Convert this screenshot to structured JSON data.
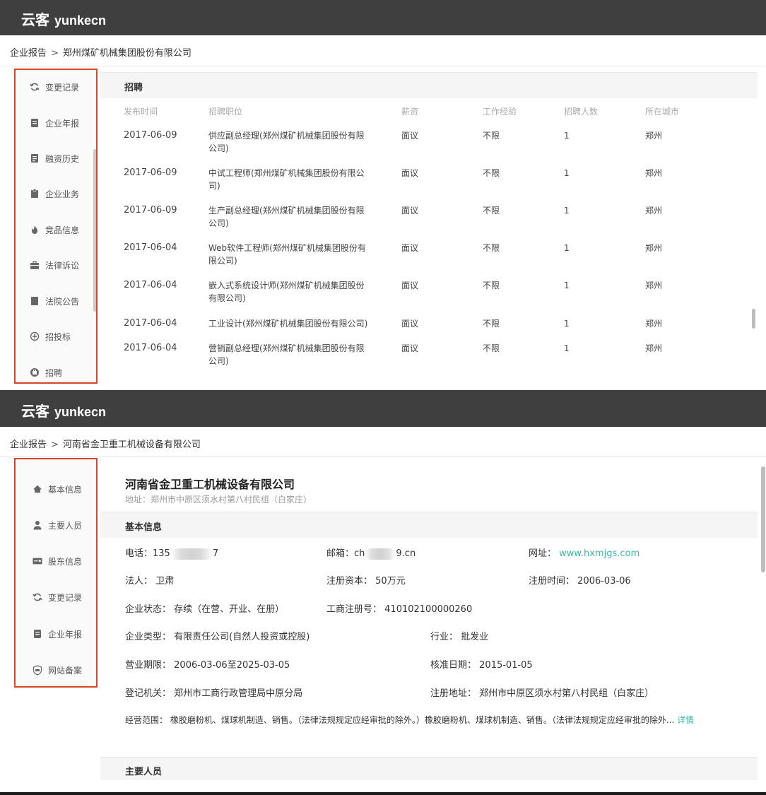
{
  "brand": {
    "cn": "云客",
    "latin": "yunkecn"
  },
  "breadcrumb_separator": ">",
  "panel1": {
    "breadcrumb": {
      "root": "企业报告",
      "current": "郑州煤矿机械集团股份有限公司"
    },
    "sidebar": [
      {
        "label": "变更记录",
        "icon": "refresh-icon"
      },
      {
        "label": "企业年报",
        "icon": "report-icon"
      },
      {
        "label": "融资历史",
        "icon": "document-icon"
      },
      {
        "label": "企业业务",
        "icon": "clipboard-icon"
      },
      {
        "label": "竞品信息",
        "icon": "flame-icon"
      },
      {
        "label": "法律诉讼",
        "icon": "briefcase-icon"
      },
      {
        "label": "法院公告",
        "icon": "notice-icon"
      },
      {
        "label": "招投标",
        "icon": "bid-icon"
      },
      {
        "label": "招聘",
        "icon": "recruit-icon"
      }
    ],
    "section_title": "招聘",
    "columns": [
      "发布时间",
      "招聘职位",
      "薪资",
      "工作经验",
      "招聘人数",
      "所在城市"
    ],
    "rows": [
      {
        "date": "2017-06-09",
        "position_l1": "供应副总经理(郑州煤矿机械集团股份有限",
        "position_l2": "公司)",
        "salary": "面议",
        "experience": "不限",
        "count": "1",
        "city": "郑州"
      },
      {
        "date": "2017-06-09",
        "position_l1": "中试工程师(郑州煤矿机械集团股份有限公",
        "position_l2": "司)",
        "salary": "面议",
        "experience": "不限",
        "count": "1",
        "city": "郑州"
      },
      {
        "date": "2017-06-09",
        "position_l1": "生产副总经理(郑州煤矿机械集团股份有限",
        "position_l2": "公司)",
        "salary": "面议",
        "experience": "不限",
        "count": "1",
        "city": "郑州"
      },
      {
        "date": "2017-06-04",
        "position_l1": "Web软件工程师(郑州煤矿机械集团股份有",
        "position_l2": "限公司)",
        "salary": "面议",
        "experience": "不限",
        "count": "1",
        "city": "郑州"
      },
      {
        "date": "2017-06-04",
        "position_l1": "嵌入式系统设计师(郑州煤矿机械集团股份",
        "position_l2": "有限公司)",
        "salary": "面议",
        "experience": "不限",
        "count": "1",
        "city": "郑州"
      },
      {
        "date": "2017-06-04",
        "position_l1": "工业设计(郑州煤矿机械集团股份有限公司)",
        "position_l2": "",
        "salary": "面议",
        "experience": "不限",
        "count": "1",
        "city": "郑州"
      },
      {
        "date": "2017-06-04",
        "position_l1": "营销副总经理(郑州煤矿机械集团股份有限",
        "position_l2": "公司)",
        "salary": "面议",
        "experience": "不限",
        "count": "1",
        "city": "郑州"
      }
    ]
  },
  "panel2": {
    "breadcrumb": {
      "root": "企业报告",
      "current": "河南省金卫重工机械设备有限公司"
    },
    "sidebar": [
      {
        "label": "基本信息",
        "icon": "home-icon"
      },
      {
        "label": "主要人员",
        "icon": "user-icon"
      },
      {
        "label": "股东信息",
        "icon": "card-icon"
      },
      {
        "label": "变更记录",
        "icon": "refresh-icon"
      },
      {
        "label": "企业年报",
        "icon": "report-icon"
      },
      {
        "label": "网站备案",
        "icon": "icp-shield-icon"
      }
    ],
    "company_name": "河南省金卫重工机械设备有限公司",
    "address": "地址：郑州市中原区须水村第八村民组（白家庄）",
    "basic_title": "基本信息",
    "fields": {
      "phone_label": "电话：",
      "phone_prefix": "135",
      "phone_suffix": "7",
      "email_label": "邮箱：",
      "email_prefix": "ch",
      "email_suffix": "9.cn",
      "website_label": "网址：",
      "website": "www.hxmjgs.com",
      "legal_label": "法人：",
      "legal": "卫肃",
      "capital_label": "注册资本：",
      "capital": "50万元",
      "regdate_label": "注册时间：",
      "regdate": "2006-03-06",
      "status_label": "企业状态：",
      "status": "存续（在营、开业、在册）",
      "regno_label": "工商注册号：",
      "regno": "410102100000260",
      "type_label": "企业类型：",
      "type": "有限责任公司(自然人投资或控股)",
      "industry_label": "行业：",
      "industry": "批发业",
      "term_label": "营业期限：",
      "term": "2006-03-06至2025-03-05",
      "approve_label": "核准日期：",
      "approve": "2015-01-05",
      "authority_label": "登记机关：",
      "authority": "郑州市工商行政管理局中原分局",
      "regaddr_label": "注册地址：",
      "regaddr": "郑州市中原区须水村第八村民组（白家庄）",
      "scope_label": "经营范围：",
      "scope": "橡胶磨粉机、煤球机制造、销售。（法律法规规定应经审批的除外。）橡胶磨粉机、煤球机制造、销售。（法律法规规定应经审批的除外...",
      "more": "详情"
    },
    "people_title": "主要人员"
  }
}
